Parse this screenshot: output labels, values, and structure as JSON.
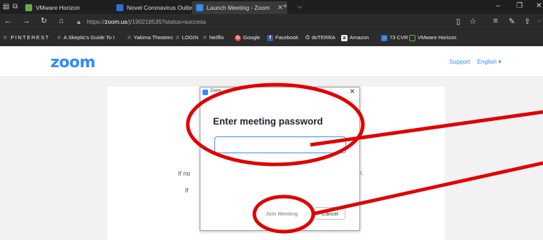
{
  "browser": {
    "tabs": [
      {
        "label": "VMware Horizon",
        "icon": "vmware-icon",
        "color": "#6aa84f"
      },
      {
        "label": "Novel Coronavirus Outbreal",
        "icon": "page-icon",
        "color": "#2d6fd6"
      },
      {
        "label": "Launch Meeting - Zoom",
        "icon": "zoom-icon",
        "color": "#2d8cff"
      }
    ],
    "url_prefix": "https://",
    "url_host": "zoom.us",
    "url_path": "/j/190218535?status=success",
    "favorites": [
      {
        "label": "PINTEREST",
        "icon": "star-icon"
      },
      {
        "label": "A Skeptic's Guide To I",
        "icon": "star-icon"
      },
      {
        "label": "Yakima Theatres",
        "icon": "star-icon"
      },
      {
        "label": "LOGIN",
        "icon": "star-icon"
      },
      {
        "label": "Netflix",
        "icon": "star-icon"
      },
      {
        "label": "Google",
        "icon": "google-icon"
      },
      {
        "label": "Facebook",
        "icon": "facebook-icon"
      },
      {
        "label": "doTERRA",
        "icon": "doterra-icon"
      },
      {
        "label": "Amazon",
        "icon": "amazon-icon"
      },
      {
        "label": "73 CVR",
        "icon": "cvr-icon"
      },
      {
        "label": "VMware Horizon",
        "icon": "monitor-icon"
      }
    ]
  },
  "page": {
    "logo": "zoom",
    "support": "Support",
    "language": "English",
    "partial_text_1": "If no",
    "partial_text_2": "If",
    "partial_link": "m."
  },
  "dialog": {
    "title": "Zoom",
    "heading": "Enter meeting password",
    "password_value": "",
    "join_label": "Join Meeting",
    "cancel_label": "Cancel"
  },
  "colors": {
    "accent": "#2d8cff",
    "annotation": "#e00000"
  }
}
